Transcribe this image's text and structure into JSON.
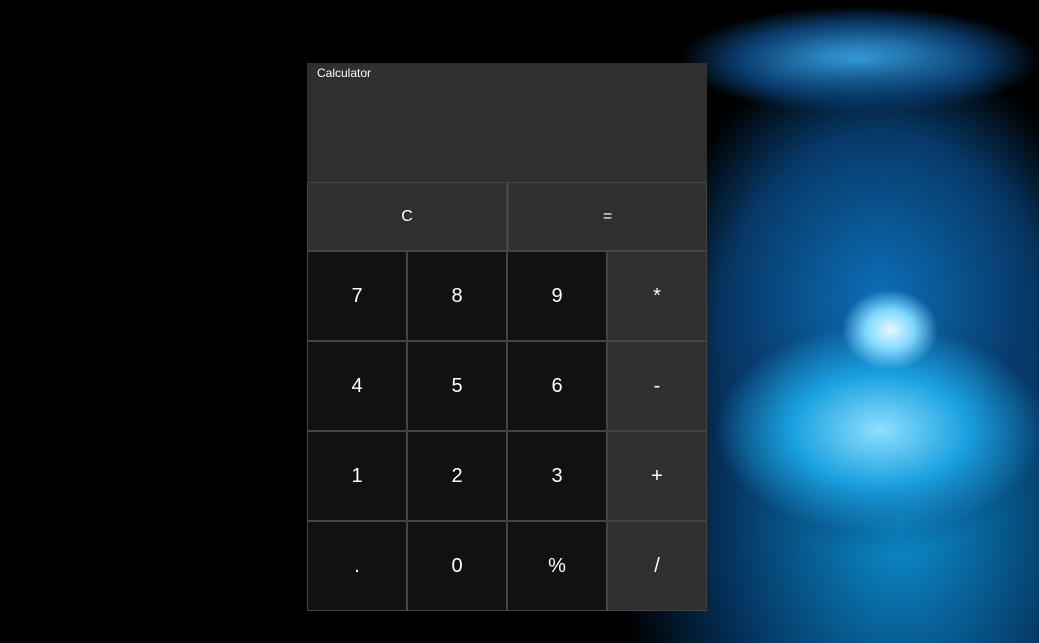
{
  "window": {
    "title": "Calculator"
  },
  "display": {
    "value": ""
  },
  "top_row": [
    {
      "label": "C",
      "name": "clear-button"
    },
    {
      "label": "=",
      "name": "equals-button"
    }
  ],
  "keys": [
    [
      {
        "label": "7",
        "type": "num"
      },
      {
        "label": "8",
        "type": "num"
      },
      {
        "label": "9",
        "type": "num"
      },
      {
        "label": "*",
        "type": "op"
      }
    ],
    [
      {
        "label": "4",
        "type": "num"
      },
      {
        "label": "5",
        "type": "num"
      },
      {
        "label": "6",
        "type": "num"
      },
      {
        "label": "-",
        "type": "op"
      }
    ],
    [
      {
        "label": "1",
        "type": "num"
      },
      {
        "label": "2",
        "type": "num"
      },
      {
        "label": "3",
        "type": "num"
      },
      {
        "label": "+",
        "type": "op"
      }
    ],
    [
      {
        "label": ".",
        "type": "num"
      },
      {
        "label": "0",
        "type": "num"
      },
      {
        "label": "%",
        "type": "num"
      },
      {
        "label": "/",
        "type": "op"
      }
    ]
  ],
  "colors": {
    "window": "#2f2f2f",
    "number_key": "#111111",
    "operator_key": "#2f2f2f",
    "grid_line": "#444444",
    "wallpaper_accent": "#1aa0e0"
  }
}
